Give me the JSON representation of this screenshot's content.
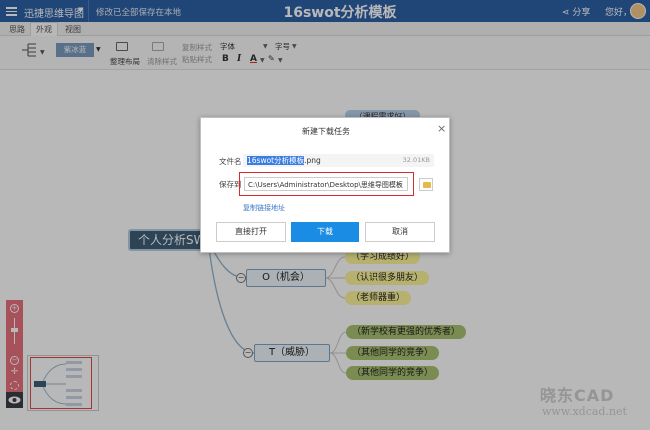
{
  "topbar": {
    "app_name": "迅捷思维导图",
    "save_status": "修改已全部保存在本地",
    "doc_title": "16swot分析模板",
    "share": "分享",
    "user": "您好，"
  },
  "tabs": [
    "思路",
    "外观",
    "视图"
  ],
  "toolbar": {
    "theme": "紫冰蓝",
    "layout": "整理布局",
    "clear_style": "清除样式",
    "copy_style": "复制样式",
    "paste_style": "粘贴样式",
    "font": "字体",
    "size": "字号",
    "bold": "B",
    "italic": "I",
    "font_color": "A"
  },
  "mindmap": {
    "central": "个人分析SWOT",
    "top_partial": "（课程需求好）",
    "topics": [
      {
        "label": "O（机会）",
        "leaves": [
          "（学习成绩好）",
          "（认识很多朋友）",
          "（老师器重）"
        ]
      },
      {
        "label": "T（威胁）",
        "leaves": [
          "（新学校有更强的优秀者）",
          "（其他同学的竞争）",
          "（其他同学的竞争）"
        ]
      }
    ]
  },
  "zoombar": {
    "plus": "+",
    "minus": "−"
  },
  "dialog": {
    "title": "新建下载任务",
    "close": "×",
    "filename_label": "文件名",
    "filename_selected": "16swot分析模板",
    "filename_ext": ".png",
    "filesize": "32.01KB",
    "saveto_label": "保存到",
    "path": "C:\\Users\\Administrator\\Desktop\\思维导图模板",
    "copy_link": "复制链接地址",
    "btn_open": "直接打开",
    "btn_download": "下载",
    "btn_cancel": "取消"
  },
  "watermark": {
    "logo": "晓东CAD",
    "url": "www.xdcad.net"
  },
  "colors": {
    "topbar": "#2d62a7",
    "primary": "#1b8ce3",
    "highlight_border": "#d92b2b",
    "leaf_yellow": "#fdf59a",
    "leaf_green": "#a9c372"
  }
}
